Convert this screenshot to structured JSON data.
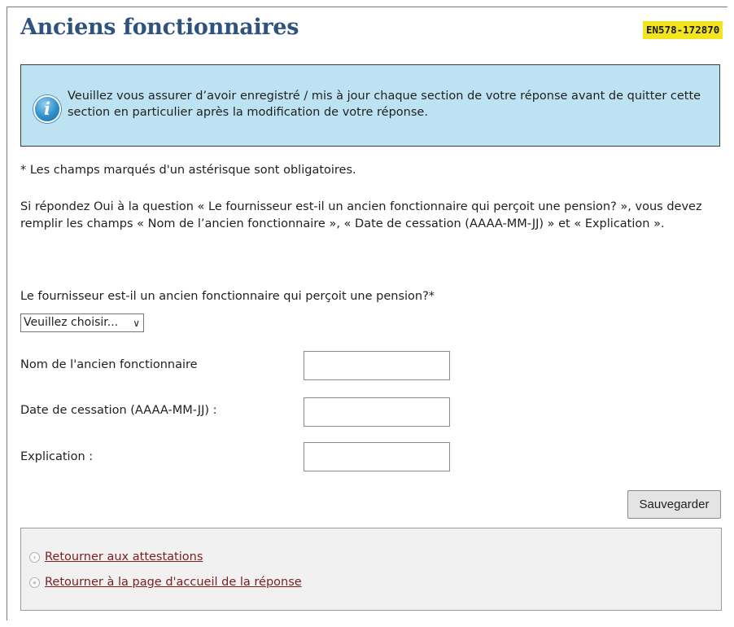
{
  "header": {
    "title": "Anciens fonctionnaires",
    "reference": "EN578-172870"
  },
  "info": {
    "icon": "info-icon",
    "message": "Veuillez vous assurer d’avoir enregistré / mis à jour chaque section de votre réponse avant de quitter cette section en particulier après la modification de votre réponse."
  },
  "form": {
    "required_note": "* Les champs marqués d'un astérisque sont obligatoires.",
    "instructions": "Si répondez Oui à la question « Le fournisseur est-il un ancien fonctionnaire qui perçoit une pension? », vous devez remplir les champs « Nom de l’ancien fonctionnaire », « Date de cessation (AAAA-MM-JJ) » et « Explication ».",
    "question": "Le fournisseur est-il un ancien fonctionnaire qui perçoit une pension?*",
    "select_value": "Veuillez choisir...",
    "fields": [
      {
        "label": "Nom de l'ancien fonctionnaire",
        "value": ""
      },
      {
        "label": "Date de cessation (AAAA-MM-JJ) :",
        "value": ""
      },
      {
        "label": "Explication :",
        "value": ""
      }
    ],
    "save_label": "Sauvegarder"
  },
  "nav": {
    "links": [
      {
        "label": "Retourner aux attestations",
        "icon": "single-chevron-left-icon"
      },
      {
        "label": "Retourner à la page d'accueil de la réponse",
        "icon": "double-chevron-left-icon"
      }
    ]
  },
  "colors": {
    "title": "#2f5380",
    "badge": "#f2e41d",
    "info_background": "#bde3f2",
    "link": "#7a1f1f"
  }
}
